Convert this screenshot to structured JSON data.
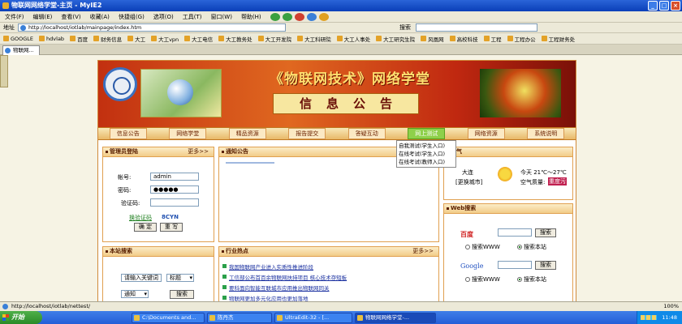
{
  "window": {
    "title": "物联网网络学堂-主页 - MyIE2"
  },
  "menu": [
    "文件(F)",
    "编辑(E)",
    "查看(V)",
    "收藏(A)",
    "快捷组(G)",
    "选项(O)",
    "工具(T)",
    "窗口(W)",
    "帮助(H)"
  ],
  "address": {
    "label": "地址",
    "url": "http://localhost/iotlab/mainpage/index.htm",
    "search_label": "搜索"
  },
  "favorites": [
    "GOOGLE",
    "hdvlab",
    "百度",
    "财务信息",
    "大工",
    "大工vpn",
    "大工电信",
    "大工教务处",
    "大工开发院",
    "大工科研院",
    "大工人事处",
    "大工研究生院",
    "风凰网",
    "高校科技",
    "工程",
    "工程办公",
    "工程财务处"
  ],
  "tab": {
    "label": "物联网..."
  },
  "site": {
    "banner_title": "《物联网技术》网络学堂",
    "banner_subtitle": "信息公告",
    "nav": [
      "信息公告",
      "网络学堂",
      "精品资源",
      "报告提交",
      "答疑互动",
      "网上测试",
      "网络资源",
      "系统说明"
    ],
    "dropdown": [
      "自我测试(学生入口)",
      "在线考试(学生入口)",
      "在线考试(教师入口)"
    ],
    "login": {
      "title": "管理员登陆",
      "more": "更多>>",
      "user_label": "帐号:",
      "user_value": "admin",
      "pwd_label": "密码:",
      "pwd_value": "●●●●●",
      "code_label": "验证码:",
      "change_code": "换验证码",
      "code_text": "8CYN",
      "ok": "确 定",
      "reset": "重 写"
    },
    "notice": {
      "title": "通知公告"
    },
    "weather": {
      "title": "天气",
      "city": "大连",
      "change_city": "[更换城市]",
      "temp": "今天 21℃～27℃",
      "air_label": "空气质量:",
      "air_value": "重度污"
    },
    "sitesearch": {
      "title": "本站搜索",
      "keyword": "请输入关键词",
      "field": "标题",
      "type": "通知",
      "button": "搜索"
    },
    "hot": {
      "title": "行业热点",
      "more": "更多>>",
      "items": [
        "我国物联网产业进入实质性推进阶段",
        "工信部公布首百余物联网扶持项目 核心技术存短板",
        "要科面向智能互联城市应用推出物联网同关",
        "物联网更加多元化应用也更加落地"
      ]
    },
    "websearch": {
      "title": "Web搜索",
      "baidu": "百度",
      "google": "Google",
      "button": "搜索",
      "opt_www": "搜索WWW",
      "opt_site": "搜索本站"
    }
  },
  "status": {
    "url": "http://localhost/iotlab/nettest/",
    "zoom": "100%"
  },
  "taskbar": {
    "start": "开始",
    "items": [
      "C:\\Documents and...",
      "陈丹杰",
      "UltraEdit-32 - [...",
      "物联网网络学堂-..."
    ],
    "clock": "11:48"
  }
}
